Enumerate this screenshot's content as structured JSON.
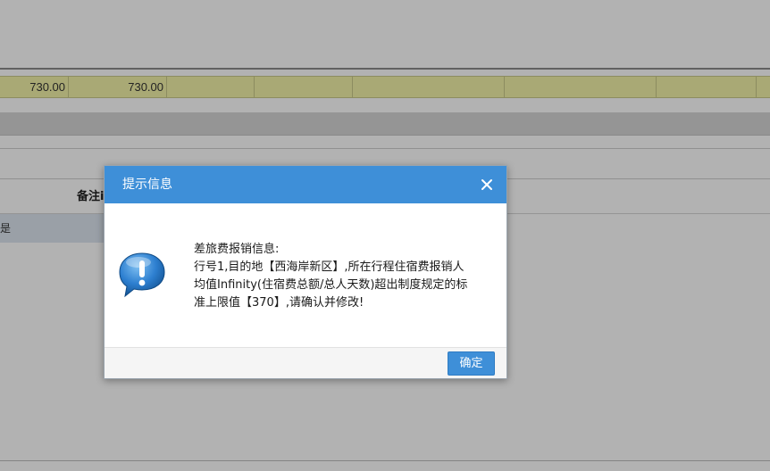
{
  "background": {
    "total_row": {
      "cells": [
        "730.00",
        "730.00",
        "",
        "",
        "",
        "",
        "",
        ""
      ]
    },
    "table_header": {
      "remark_label": "备注i"
    },
    "data_row": {
      "text": "是"
    }
  },
  "dialog": {
    "title": "提示信息",
    "message_lines": [
      "差旅费报销信息:",
      "行号1,目的地【西海岸新区】,所在行程住宿费报销人",
      "均值Infinity(住宿费总额/总人天数)超出制度规定的标",
      "准上限值【370】,请确认并修改!"
    ],
    "ok_label": "确定",
    "icons": {
      "info": "info-speech-bubble-icon",
      "close": "close-icon"
    }
  },
  "colors": {
    "header_blue": "#3e8fd8",
    "total_row_yellow": "#f3f3a8",
    "overlay": "rgba(0,0,0,0.30)"
  }
}
